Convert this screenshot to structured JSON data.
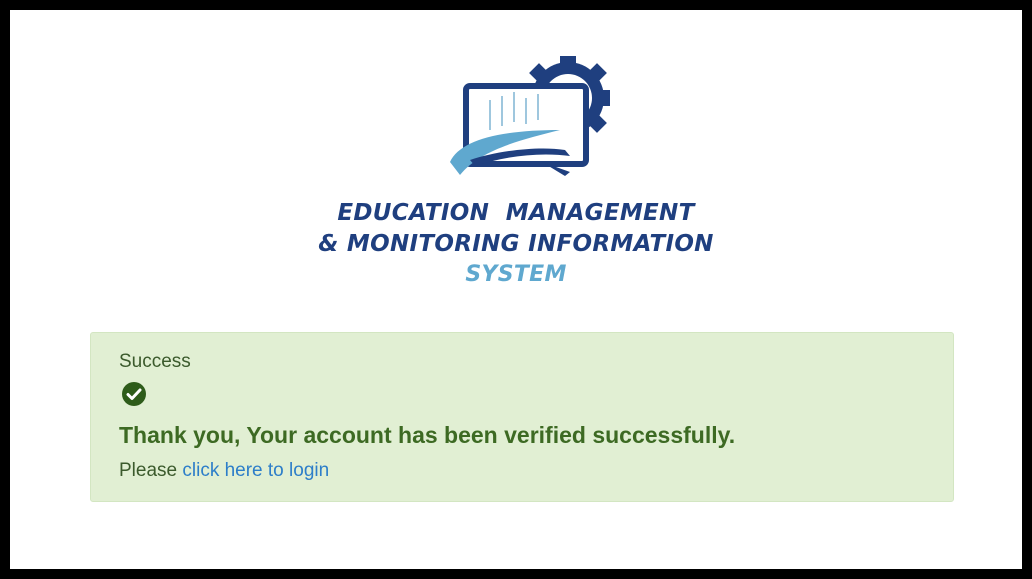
{
  "logo": {
    "line1": "EDUCATION  MANAGEMENT",
    "line2": "& MONITORING INFORMATION",
    "line3": "SYSTEM",
    "colors": {
      "primary": "#1f3f7f",
      "accent": "#5fa8cf"
    },
    "icon": "monitor-gear-icon"
  },
  "alert": {
    "title": "Success",
    "icon": "check-circle-icon",
    "message": "Thank you, Your account has been verified successfully.",
    "login_prefix": "Please ",
    "login_link": "click here to login",
    "colors": {
      "background": "#e1efd3",
      "text": "#3d6a23",
      "link": "#2d7ec9"
    }
  }
}
